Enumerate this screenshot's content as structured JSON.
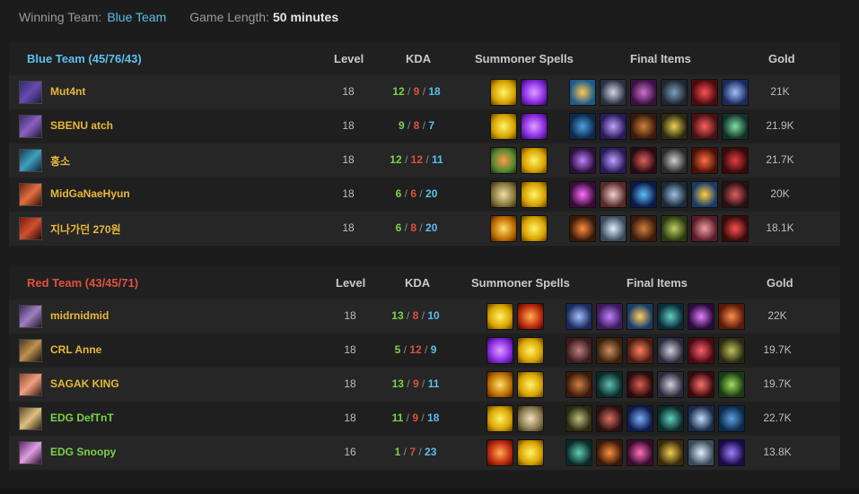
{
  "header": {
    "winning_label": "Winning Team:",
    "winning_team": "Blue Team",
    "length_label": "Game Length:",
    "length_value": "50 minutes"
  },
  "columns": {
    "level": "Level",
    "kda": "KDA",
    "spells": "Summoner Spells",
    "items": "Final Items",
    "gold": "Gold"
  },
  "blue": {
    "title": "Blue Team (45/76/43)",
    "players": [
      {
        "name": "Mut4nt",
        "level": "18",
        "k": "12",
        "d": "9",
        "a": "18",
        "gold": "21K"
      },
      {
        "name": "SBENU atch",
        "level": "18",
        "k": "9",
        "d": "8",
        "a": "7",
        "gold": "21.9K"
      },
      {
        "name": "홍소",
        "level": "18",
        "k": "12",
        "d": "12",
        "a": "11",
        "gold": "21.7K"
      },
      {
        "name": "MidGaNaeHyun",
        "level": "18",
        "k": "6",
        "d": "6",
        "a": "20",
        "gold": "20K"
      },
      {
        "name": "지나가던 270원",
        "level": "18",
        "k": "6",
        "d": "8",
        "a": "20",
        "gold": "18.1K"
      }
    ]
  },
  "red": {
    "title": "Red Team (43/45/71)",
    "players": [
      {
        "name": "midrnidmid",
        "level": "18",
        "k": "13",
        "d": "8",
        "a": "10",
        "gold": "22K"
      },
      {
        "name": "CRL Anne",
        "level": "18",
        "k": "5",
        "d": "12",
        "a": "9",
        "gold": "19.7K"
      },
      {
        "name": "SAGAK KING",
        "level": "18",
        "k": "13",
        "d": "9",
        "a": "11",
        "gold": "19.7K"
      },
      {
        "name": "EDG DefTnT",
        "level": "18",
        "k": "11",
        "d": "9",
        "a": "18",
        "gold": "22.7K"
      },
      {
        "name": "EDG Snoopy",
        "level": "16",
        "k": "1",
        "d": "7",
        "a": "23",
        "gold": "13.8K"
      }
    ]
  },
  "kda_separator": "/"
}
